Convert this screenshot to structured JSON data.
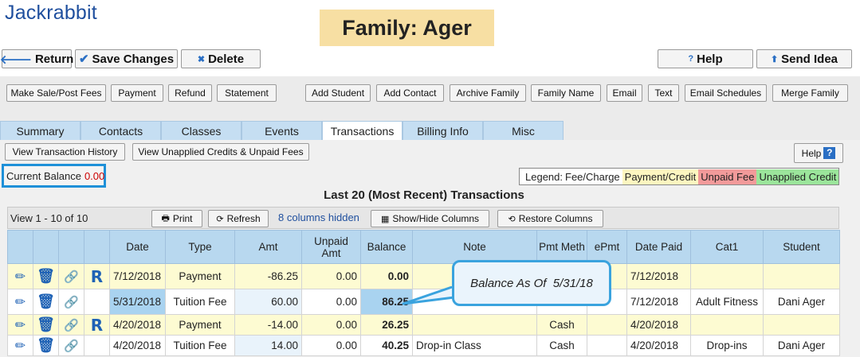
{
  "app": {
    "logo": "Jackrabbit"
  },
  "family_title": "Family: Ager",
  "top_buttons": {
    "return": "Return",
    "save": "Save Changes",
    "delete": "Delete",
    "help": "Help",
    "send_idea": "Send Idea"
  },
  "actions": [
    "Make Sale/Post Fees",
    "Payment",
    "Refund",
    "Statement",
    "Add Student",
    "Add Contact",
    "Archive Family",
    "Family Name",
    "Email",
    "Text",
    "Email Schedules",
    "Merge Family"
  ],
  "tabs": [
    "Summary",
    "Contacts",
    "Classes",
    "Events",
    "Transactions",
    "Billing Info",
    "Misc"
  ],
  "active_tab": "Transactions",
  "sub_buttons": {
    "history": "View Transaction History",
    "unapplied": "View Unapplied Credits & Unpaid Fees",
    "help": "Help"
  },
  "current_balance": {
    "label": "Current Balance",
    "value": "0.00"
  },
  "legend": {
    "title": "Legend:",
    "fee": "Fee/Charge",
    "payment": "Payment/Credit",
    "unpaid": "Unpaid Fee",
    "unapplied": "Unapplied Credit"
  },
  "list_title": "Last 20 (Most Recent) Transactions",
  "grid_toolbar": {
    "view_count": "View 1 - 10 of 10",
    "print": "Print",
    "refresh": "Refresh",
    "hidden": "8 columns hidden",
    "show_hide": "Show/Hide Columns",
    "restore": "Restore Columns"
  },
  "columns": {
    "date": "Date",
    "type": "Type",
    "amt": "Amt",
    "unpaid_amt": "Unpaid Amt",
    "balance": "Balance",
    "note": "Note",
    "pmt_meth": "Pmt Meth",
    "epmt": "ePmt",
    "date_paid": "Date Paid",
    "cat1": "Cat1",
    "student": "Student"
  },
  "rows": [
    {
      "date": "7/12/2018",
      "type": "Payment",
      "amt": "-86.25",
      "unpaid": "0.00",
      "balance": "0.00",
      "note": "",
      "pmt": "",
      "epmt": "",
      "date_paid": "7/12/2018",
      "cat1": "",
      "student": "",
      "r": ""
    },
    {
      "date": "5/31/2018",
      "type": "Tuition Fee",
      "amt": "60.00",
      "unpaid": "0.00",
      "balance": "86.25",
      "note": "",
      "pmt": "",
      "epmt": "",
      "date_paid": "7/12/2018",
      "cat1": "Adult Fitness",
      "student": "Dani Ager",
      "r": ""
    },
    {
      "date": "4/20/2018",
      "type": "Payment",
      "amt": "-14.00",
      "unpaid": "0.00",
      "balance": "26.25",
      "note": "",
      "pmt": "Cash",
      "epmt": "",
      "date_paid": "4/20/2018",
      "cat1": "",
      "student": "",
      "r": "R"
    },
    {
      "date": "4/20/2018",
      "type": "Tuition Fee",
      "amt": "14.00",
      "unpaid": "0.00",
      "balance": "40.25",
      "note": "Drop-in Class",
      "pmt": "Cash",
      "epmt": "",
      "date_paid": "4/20/2018",
      "cat1": "Drop-ins",
      "student": "Dani Ager",
      "r": ""
    }
  ],
  "row0_r": "R",
  "callout": "Balance As Of  5/31/18",
  "colors": {
    "brand": "#1f4f9e",
    "title_bg": "#f7dfa3",
    "tab_bg": "#c5def2",
    "header_bg": "#b8d8ef",
    "payment_row": "#fdfbd2",
    "highlight": "#a9d3f0",
    "callout_border": "#3aa3de",
    "negative_balance": "#cc0000"
  }
}
